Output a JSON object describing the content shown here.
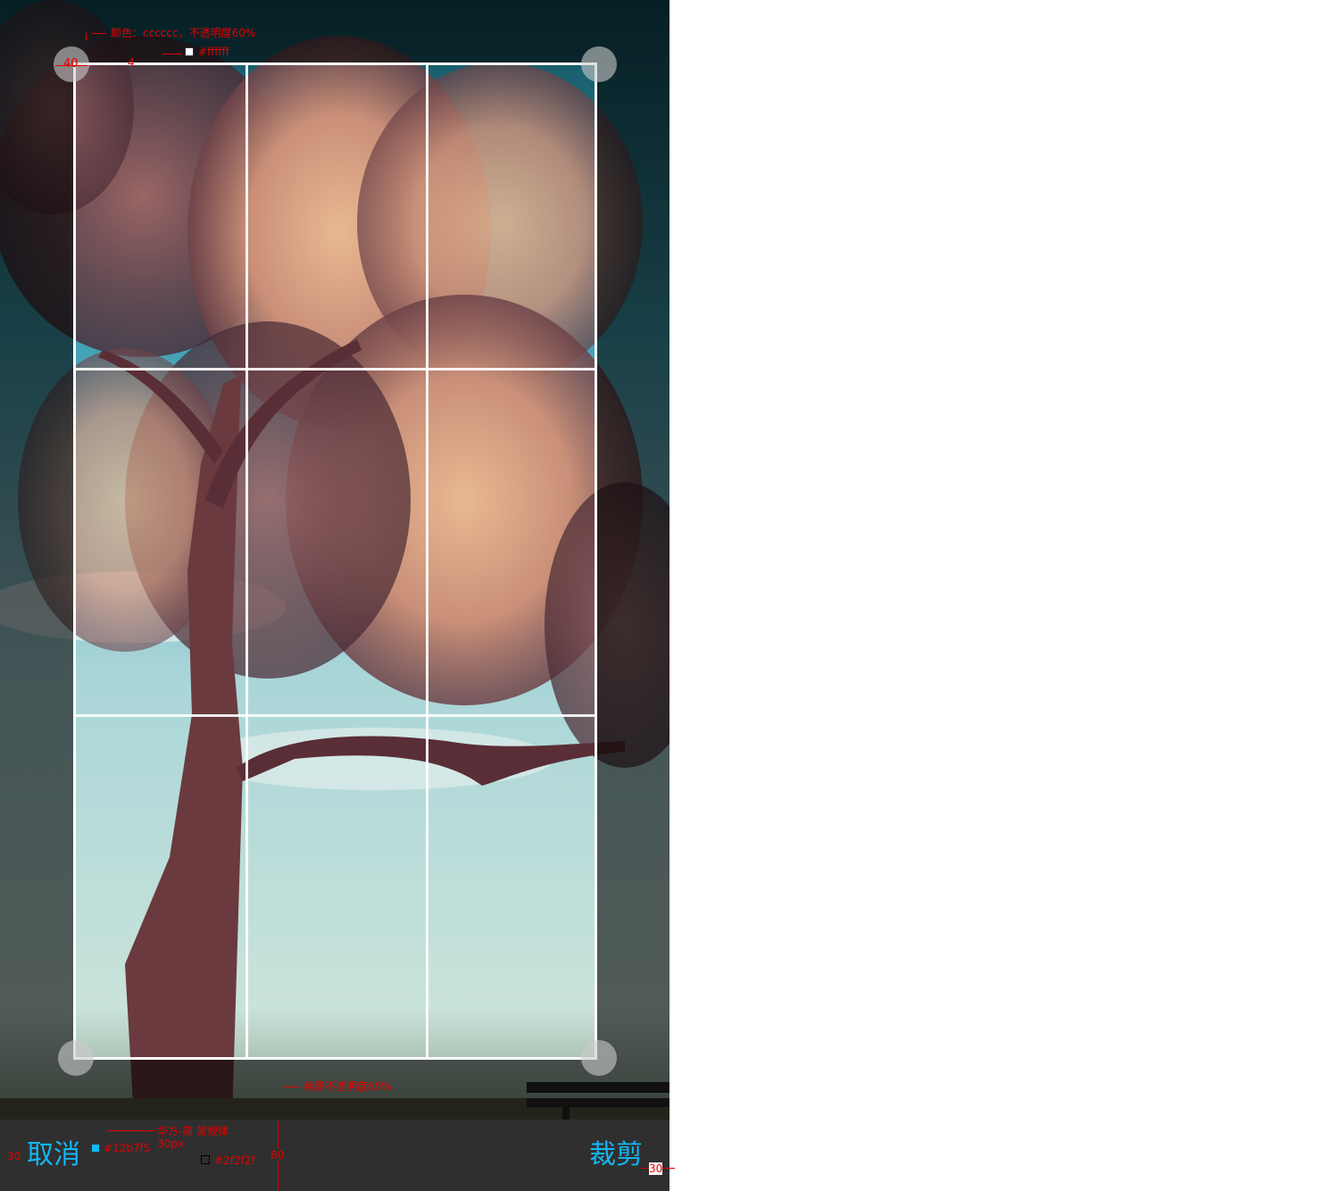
{
  "bottom_bar": {
    "cancel_label": "取消",
    "crop_label": "裁剪",
    "background": "#2f2f2f",
    "text_color": "#12b7f5"
  },
  "crop_frame": {
    "grid_color": "#ffffff",
    "handle_color": "#cccccc",
    "handle_opacity": "60%",
    "mask": "rgba(0,0,0,0.6)"
  },
  "annotations": {
    "handle_color_note": "颜色：cccccc，不透明度60%",
    "handle_size": "40",
    "border_width": "4",
    "grid_color_note": "#ffffff",
    "mask_note": "纯黑不透明度60%",
    "font_note_line1": "华方-简 常规体",
    "font_note_line2": "30px",
    "text_color_note": "#12b7f5",
    "bar_color_note": "#2f2f2f",
    "bar_height": "80",
    "left_margin": "30",
    "right_margin": "30"
  }
}
